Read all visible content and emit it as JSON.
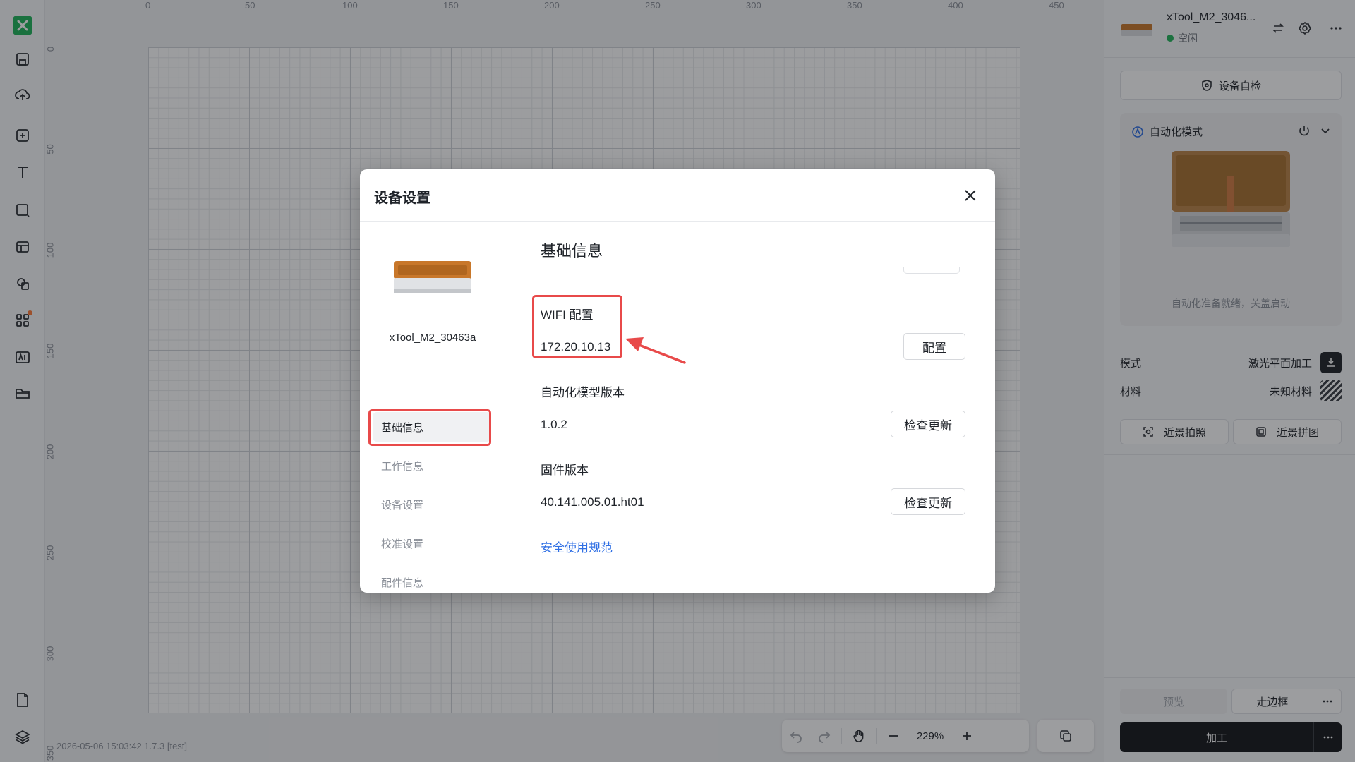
{
  "app": {
    "footer_meta": "2026-05-06 15:03:42 1.7.3 [test]"
  },
  "left_toolbar": {
    "tools": [
      "logo",
      "save-icon",
      "cloud-upload-icon",
      "add-box-icon",
      "text-icon",
      "shape-icon",
      "layout-icon",
      "copy-shapes-icon",
      "apps-icon",
      "ai-image-icon",
      "folder-icon",
      "document-icon",
      "layers-icon"
    ]
  },
  "rulers": {
    "top": [
      "0",
      "50",
      "100",
      "150",
      "200",
      "250",
      "300",
      "350",
      "400",
      "450"
    ],
    "left": [
      "0",
      "50",
      "100",
      "150",
      "200",
      "250",
      "300",
      "350"
    ]
  },
  "bottom_tools": {
    "zoom": "229%"
  },
  "right_panel": {
    "device_name": "xTool_M2_3046...",
    "device_status": "空闲",
    "self_check": "设备自检",
    "auto_mode_title": "自动化模式",
    "auto_hint": "自动化准备就绪，关盖启动",
    "mode_label": "模式",
    "mode_value": "激光平面加工",
    "material_label": "材料",
    "material_value": "未知材料",
    "closeup_photo": "近景拍照",
    "closeup_stitch": "近景拼图",
    "preview": "预览",
    "walk_frame": "走边框",
    "process": "加工"
  },
  "dialog": {
    "title": "设备设置",
    "device_name": "xTool_M2_30463a",
    "nav": [
      "基础信息",
      "工作信息",
      "设备设置",
      "校准设置",
      "配件信息"
    ],
    "section_title": "基础信息",
    "wifi_label": "WIFI 配置",
    "wifi_value": "172.20.10.13",
    "wifi_button": "配置",
    "auto_model_label": "自动化模型版本",
    "auto_model_value": "1.0.2",
    "check_update": "检查更新",
    "firmware_label": "固件版本",
    "firmware_value": "40.141.005.01.ht01",
    "safety_link": "安全使用规范"
  },
  "colors": {
    "highlight": "#e84a4a",
    "link": "#2f6fe4",
    "brand": "#1fb35a",
    "status_idle": "#23b45a"
  }
}
